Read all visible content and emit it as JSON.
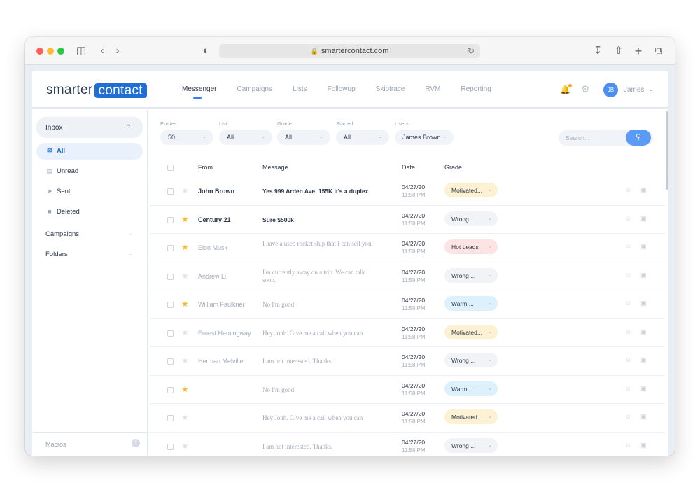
{
  "browser": {
    "url": "smartercontact.com",
    "icons": [
      "sidebar-icon",
      "back-icon",
      "forward-icon",
      "shield-icon",
      "reload-icon",
      "download-icon",
      "share-icon",
      "new-tab-icon",
      "tabs-icon"
    ]
  },
  "app": {
    "logo_part1": "smarter",
    "logo_part2": "contact",
    "nav": [
      "Messenger",
      "Campaigns",
      "Lists",
      "Followup",
      "Skiptrace",
      "RVM",
      "Reporting"
    ],
    "active_nav": "Messenger",
    "user_initials": "JB",
    "user_name": "James",
    "accent": "#1f6fd6"
  },
  "sidebar": {
    "inbox_label": "Inbox",
    "items": [
      {
        "label": "All",
        "icon": "envelope-icon"
      },
      {
        "label": "Unread",
        "icon": "inbox-icon"
      },
      {
        "label": "Sent",
        "icon": "send-icon"
      },
      {
        "label": "Deleted",
        "icon": "trash-icon"
      }
    ],
    "sections": [
      "Campaigns",
      "Folders"
    ],
    "macros_label": "Macros"
  },
  "filters": {
    "entries": {
      "label": "Entries",
      "value": "50"
    },
    "list": {
      "label": "List",
      "value": "All"
    },
    "grade": {
      "label": "Grade",
      "value": "All"
    },
    "starred": {
      "label": "Starred",
      "value": "All"
    },
    "users": {
      "label": "Users",
      "value": "James Brown"
    },
    "search_placeholder": "Search..."
  },
  "table": {
    "headers": {
      "from": "From",
      "message": "Message",
      "date": "Date",
      "grade": "Grade"
    },
    "rows": [
      {
        "from": "John Brown",
        "message": "Yes 999 Arden Ave. 155K it's a duplex",
        "date": "04/27/20",
        "time": "11:58 PM",
        "grade": "Motivated...",
        "starred": false,
        "unread": true
      },
      {
        "from": "Century 21",
        "message": "Sure $500k",
        "date": "04/27/20",
        "time": "11:58 PM",
        "grade": "Wrong ...",
        "starred": true,
        "unread": true
      },
      {
        "from": "Elon Musk",
        "message": "I have a used rocket ship that I can sell you.",
        "date": "04/27/20",
        "time": "11:58 PM",
        "grade": "Hot Leads",
        "starred": true,
        "unread": false
      },
      {
        "from": "Andrew Li",
        "message": "I'm currently away on a trip. We can talk soon.",
        "date": "04/27/20",
        "time": "11:58 PM",
        "grade": "Wrong ...",
        "starred": false,
        "unread": false
      },
      {
        "from": "William Faulkner",
        "message": "No I'm good",
        "date": "04/27/20",
        "time": "11:58 PM",
        "grade": "Warm ...",
        "starred": true,
        "unread": false
      },
      {
        "from": "Ernest Hemingway",
        "message": "Hey Jonh. Give me a call when you can",
        "date": "04/27/20",
        "time": "11:58 PM",
        "grade": "Motivated...",
        "starred": false,
        "unread": false
      },
      {
        "from": "Herman Melville",
        "message": "I am not interested. Thanks.",
        "date": "04/27/20",
        "time": "11:58 PM",
        "grade": "Wrong ...",
        "starred": false,
        "unread": false
      },
      {
        "from": "",
        "message": "No I'm good",
        "date": "04/27/20",
        "time": "11:58 PM",
        "grade": "Warm ...",
        "starred": true,
        "unread": false
      },
      {
        "from": "",
        "message": "Hey Jonh. Give me a call when you can",
        "date": "04/27/20",
        "time": "11:58 PM",
        "grade": "Motivated...",
        "starred": false,
        "unread": false
      },
      {
        "from": "",
        "message": "I am not interested. Thanks.",
        "date": "04/27/20",
        "time": "11:58 PM",
        "grade": "Wrong ...",
        "starred": false,
        "unread": false
      }
    ]
  },
  "grade_colors": {
    "Motivated...": "#fdf1d3",
    "Wrong ...": "#f1f3f6",
    "Hot Leads": "#fde3e3",
    "Warm ...": "#dcf1fb"
  }
}
